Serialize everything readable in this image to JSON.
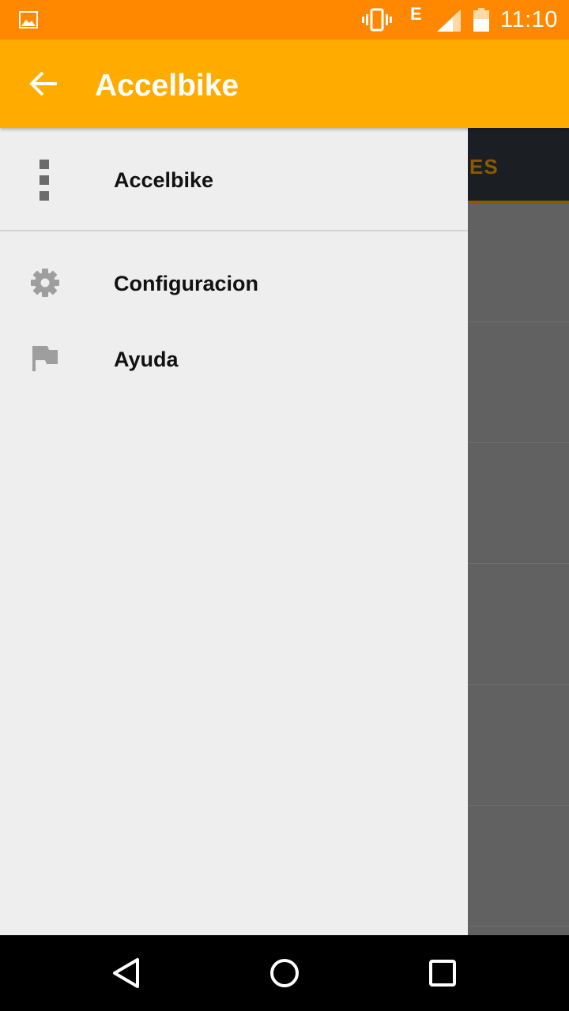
{
  "status_bar": {
    "network_type": "E",
    "time": "11:10",
    "icons": [
      "image-notification-icon",
      "vibrate-icon",
      "signal-icon",
      "battery-icon"
    ],
    "background_color": "#ff8800"
  },
  "app_bar": {
    "title": "Accelbike",
    "back_icon": "arrow-back-icon",
    "background_color": "#ffab00"
  },
  "background": {
    "tab_label_fragment": "ES"
  },
  "drawer": {
    "header": {
      "label": "Accelbike",
      "icon": "more-vert-icon"
    },
    "items": [
      {
        "label": "Configuracion",
        "icon": "gear-icon"
      },
      {
        "label": "Ayuda",
        "icon": "flag-icon"
      }
    ]
  },
  "nav_bar": {
    "buttons": [
      "back-triangle-icon",
      "home-circle-icon",
      "recents-square-icon"
    ]
  }
}
